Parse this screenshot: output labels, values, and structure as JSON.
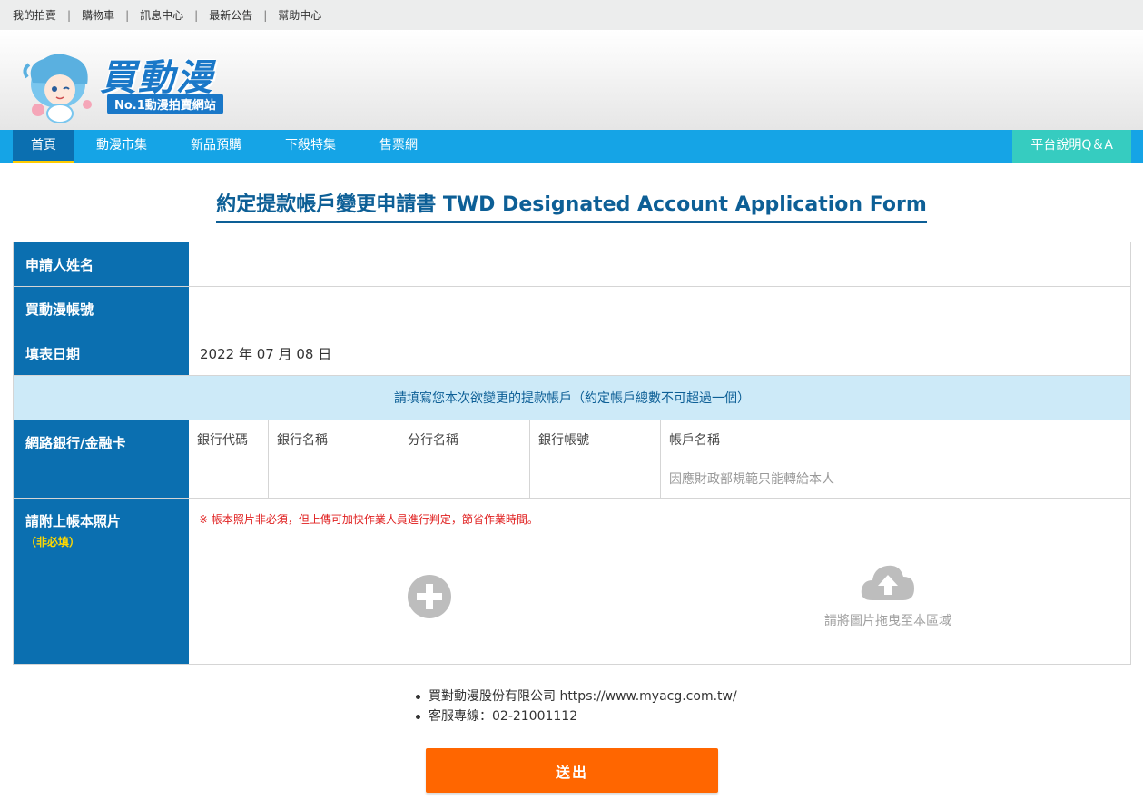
{
  "topbar": {
    "links": [
      "我的拍賣",
      "購物車",
      "訊息中心",
      "最新公告",
      "幫助中心"
    ]
  },
  "header": {
    "brand": "買動漫",
    "slogan": "No.1動漫拍賣網站"
  },
  "nav": {
    "items": [
      "首頁",
      "動漫市集",
      "新品預購",
      "下殺特集",
      "售票網"
    ],
    "active": "首頁",
    "qa": "平台說明Q＆A"
  },
  "form": {
    "title": "約定提款帳戶變更申請書 TWD Designated Account Application Form",
    "applicant_label": "申請人姓名",
    "applicant_value": "",
    "account_label": "買動漫帳號",
    "account_value": "",
    "date_label": "填表日期",
    "date_value": "2022 年 07 月 08 日",
    "notice": "請填寫您本次欲變更的提款帳戶（約定帳戶總數不可超過一個）",
    "bank_label": "網路銀行/金融卡",
    "bank_headers": [
      "銀行代碼",
      "銀行名稱",
      "分行名稱",
      "銀行帳號",
      "帳戶名稱"
    ],
    "bank_cells": [
      "",
      "",
      "",
      "",
      "因應財政部規範只能轉給本人"
    ],
    "photo_label": "請附上帳本照片",
    "photo_optional": "（非必填）",
    "photo_warning": "※ 帳本照片非必須，但上傳可加快作業人員進行判定，節省作業時間。",
    "drop_text": "請將圖片拖曳至本區域"
  },
  "footer": {
    "company": "買對動漫股份有限公司 https://www.myacg.com.tw/",
    "hotline": "客服專線：02-21001112"
  },
  "submit_label": "送出",
  "colors": {
    "nav_bg": "#15a4e6",
    "label_bg": "#0b6fb0",
    "notice_bg": "#cdeaf8",
    "qa_bg": "#36ccc0",
    "submit_bg": "#ff6600",
    "title": "#0d5f96"
  }
}
